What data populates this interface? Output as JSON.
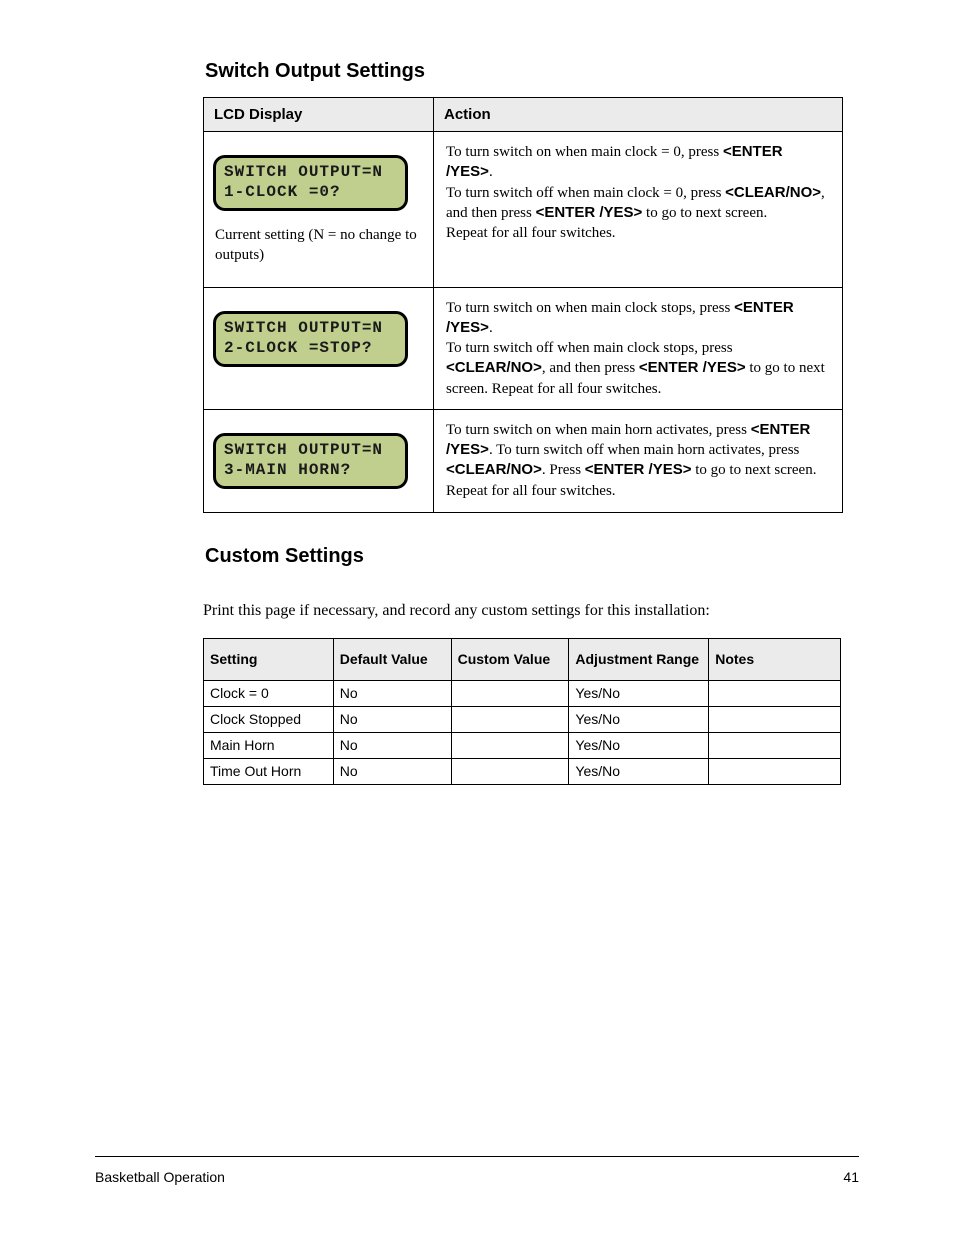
{
  "headings": {
    "switch_output": "Switch Output Settings",
    "custom_settings": "Custom Settings"
  },
  "settings_table": {
    "head_lcd": "LCD Display",
    "head_action": "Action",
    "rows": [
      {
        "lcd_line1": "SWITCH OUTPUT=N",
        "lcd_line2": "1-CLOCK =0?",
        "note": "Current setting (N = no change to outputs)",
        "desc_html": "To turn switch on when main clock = 0, press <b class='ui'>&lt;ENTER /YES&gt;</b>.<br>To turn switch off when main clock = 0, press <b class='ui'>&lt;CLEAR/NO&gt;</b>, and then press <b class='ui'>&lt;ENTER /YES&gt;</b> to go to next screen.<br>Repeat for all four switches."
      },
      {
        "lcd_line1": "SWITCH OUTPUT=N",
        "lcd_line2": "2-CLOCK =STOP?",
        "note": "",
        "desc_html": "To turn switch on when main clock stops, press <b class='ui'>&lt;ENTER /YES&gt;</b>.<br>To turn switch off when main clock stops, press <b class='ui'>&lt;CLEAR/NO&gt;</b>, and then press <b class='ui'>&lt;ENTER /YES&gt;</b> to go to next screen. Repeat for all four switches."
      },
      {
        "lcd_line1": "SWITCH OUTPUT=N",
        "lcd_line2": "3-MAIN HORN?",
        "note": "",
        "desc_html": "To turn switch on when main horn activates, press <b class='ui'>&lt;ENTER /YES&gt;</b>. To turn switch off when main horn activates, press <b class='ui'>&lt;CLEAR/NO&gt;</b>. Press <b class='ui'>&lt;ENTER /YES&gt;</b> to go to next screen. Repeat for all four switches."
      }
    ]
  },
  "intro_text": "Print this page if necessary, and record any custom settings for this installation:",
  "custom_table": {
    "headers": [
      "Setting",
      "Default Value",
      "Custom Value",
      "Adjustment Range",
      "Notes"
    ],
    "rows": [
      {
        "setting": "Clock = 0",
        "default": "No",
        "custom": "",
        "range": "Yes/No",
        "notes": ""
      },
      {
        "setting": "Clock Stopped",
        "default": "No",
        "custom": "",
        "range": "Yes/No",
        "notes": ""
      },
      {
        "setting": "Main Horn",
        "default": "No",
        "custom": "",
        "range": "Yes/No",
        "notes": ""
      },
      {
        "setting": "Time Out Horn",
        "default": "No",
        "custom": "",
        "range": "Yes/No",
        "notes": ""
      }
    ]
  },
  "footer": {
    "left": "Basketball Operation",
    "right": "41"
  }
}
